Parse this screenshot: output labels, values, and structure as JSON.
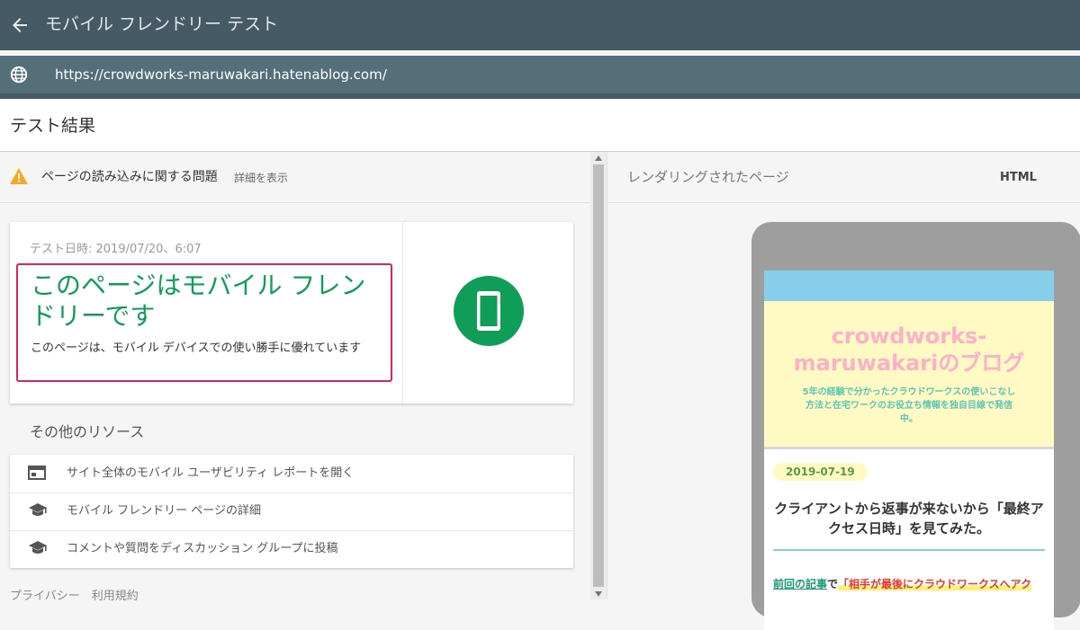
{
  "header": {
    "title": "モバイル フレンドリー テスト",
    "url": "https://crowdworks-maruwakari.hatenablog.com/"
  },
  "result": {
    "title": "テスト結果",
    "issue_text": "ページの読み込みに関する問題",
    "issue_link": "詳細を表示",
    "test_date": "テスト日時: 2019/07/20、6:07",
    "verdict": "このページはモバイル フレンドリーです",
    "verdict_sub": "このページは、モバイル デバイスでの使い勝手に優れています"
  },
  "resources": {
    "heading": "その他のリソース",
    "items": [
      {
        "label": "サイト全体のモバイル ユーザビリティ レポートを開く",
        "icon": "browser-window-icon"
      },
      {
        "label": "モバイル フレンドリー ページの詳細",
        "icon": "graduation-cap-icon"
      },
      {
        "label": "コメントや質問をディスカッション グループに投稿",
        "icon": "graduation-cap-icon"
      }
    ]
  },
  "footer": {
    "text": "プライバシー　利用規約"
  },
  "rendered": {
    "title": "レンダリングされたページ",
    "tab_html": "HTML",
    "blog": {
      "title": "crowdworks-maruwakariのブログ",
      "description": "5年の経験で分かったクラウドワークスの使いこなし方法と在宅ワークのお役立ち情報を独自目線で発信中。",
      "date": "2019-07-19",
      "post_title": "クライアントから返事が来ないから「最終アクセス日時」を見てみた。",
      "snippet_link": "前回の記事",
      "snippet_mid": "で",
      "snippet_highlight": "「相手が最後にクラウドワークスへアク"
    }
  },
  "colors": {
    "header_bg": "#455a64",
    "url_bg": "#546e7a",
    "verdict_green": "#0f9d58",
    "highlight_border": "#e0215a",
    "warning": "#f9a825"
  }
}
